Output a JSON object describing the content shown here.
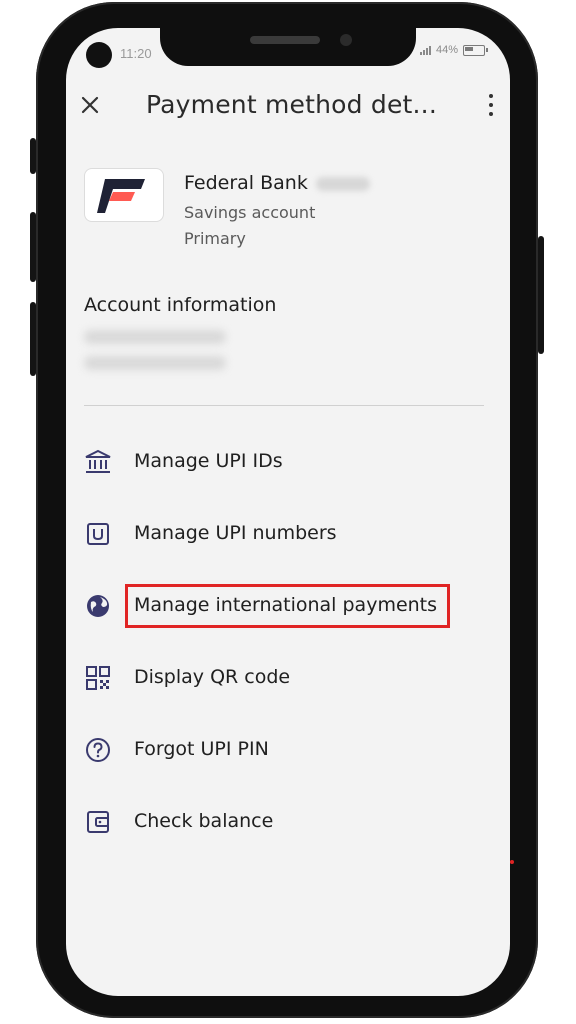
{
  "status_bar": {
    "time": "11:20",
    "battery_text": "44%"
  },
  "app_bar": {
    "title": "Payment method det...",
    "close_icon": "close-icon",
    "menu_icon": "more-vert-icon"
  },
  "bank": {
    "name": "Federal Bank",
    "account_type": "Savings account",
    "status": "Primary",
    "logo_colors": {
      "dark": "#1f2235",
      "accent": "#ff5a52"
    }
  },
  "account_info": {
    "title": "Account information"
  },
  "menu": [
    {
      "label": "Manage UPI IDs",
      "icon": "bank-icon"
    },
    {
      "label": "Manage UPI numbers",
      "icon": "upi-number-icon"
    },
    {
      "label": "Manage international payments",
      "icon": "globe-icon"
    },
    {
      "label": "Display QR code",
      "icon": "qr-code-icon"
    },
    {
      "label": "Forgot UPI PIN",
      "icon": "help-icon"
    },
    {
      "label": "Check balance",
      "icon": "wallet-icon"
    }
  ],
  "colors": {
    "icon": "#3a3a6e",
    "highlight": "#e02424"
  }
}
